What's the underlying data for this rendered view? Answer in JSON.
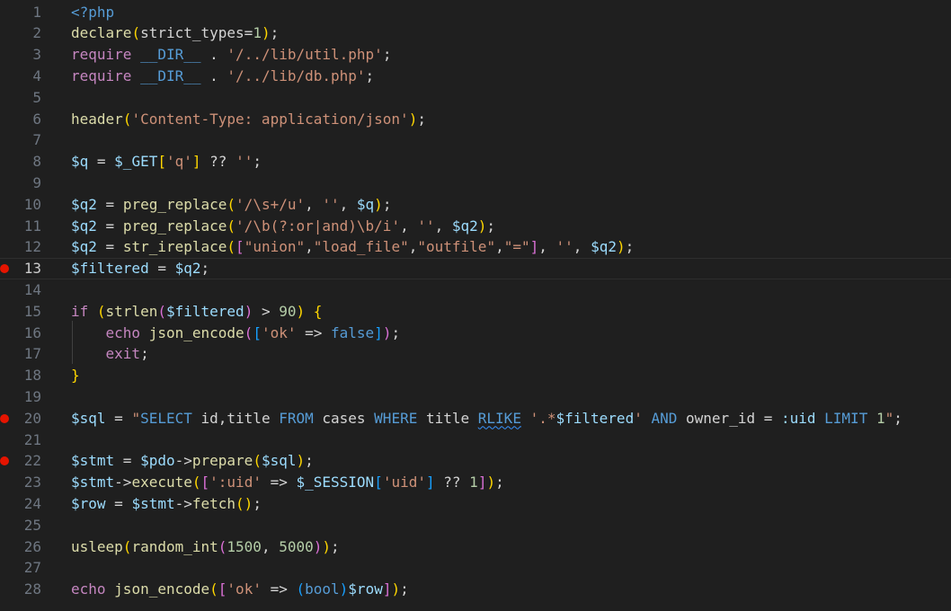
{
  "editor": {
    "lines": [
      {
        "n": "1",
        "tokens": [
          [
            "tag",
            "<?php"
          ]
        ]
      },
      {
        "n": "2",
        "tokens": [
          [
            "fn",
            "declare"
          ],
          [
            "b1",
            "("
          ],
          [
            "plain",
            "strict_types"
          ],
          [
            "op",
            "="
          ],
          [
            "num",
            "1"
          ],
          [
            "b1",
            ")"
          ],
          [
            "plain",
            ";"
          ]
        ]
      },
      {
        "n": "3",
        "tokens": [
          [
            "kw",
            "require"
          ],
          [
            "plain",
            " "
          ],
          [
            "tag",
            "__DIR__"
          ],
          [
            "plain",
            " . "
          ],
          [
            "str",
            "'/../lib/util.php'"
          ],
          [
            "plain",
            ";"
          ]
        ]
      },
      {
        "n": "4",
        "tokens": [
          [
            "kw",
            "require"
          ],
          [
            "plain",
            " "
          ],
          [
            "tag",
            "__DIR__"
          ],
          [
            "plain",
            " . "
          ],
          [
            "str",
            "'/../lib/db.php'"
          ],
          [
            "plain",
            ";"
          ]
        ]
      },
      {
        "n": "5",
        "tokens": []
      },
      {
        "n": "6",
        "tokens": [
          [
            "fn",
            "header"
          ],
          [
            "b1",
            "("
          ],
          [
            "str",
            "'Content-Type: application/json'"
          ],
          [
            "b1",
            ")"
          ],
          [
            "plain",
            ";"
          ]
        ]
      },
      {
        "n": "7",
        "tokens": []
      },
      {
        "n": "8",
        "tokens": [
          [
            "var",
            "$q"
          ],
          [
            "plain",
            " = "
          ],
          [
            "var",
            "$_GET"
          ],
          [
            "b1",
            "["
          ],
          [
            "str",
            "'q'"
          ],
          [
            "b1",
            "]"
          ],
          [
            "plain",
            " ?? "
          ],
          [
            "str",
            "''"
          ],
          [
            "plain",
            ";"
          ]
        ]
      },
      {
        "n": "9",
        "tokens": []
      },
      {
        "n": "10",
        "tokens": [
          [
            "var",
            "$q2"
          ],
          [
            "plain",
            " = "
          ],
          [
            "fn",
            "preg_replace"
          ],
          [
            "b1",
            "("
          ],
          [
            "str",
            "'/\\s+/u'"
          ],
          [
            "plain",
            ", "
          ],
          [
            "str",
            "''"
          ],
          [
            "plain",
            ", "
          ],
          [
            "var",
            "$q"
          ],
          [
            "b1",
            ")"
          ],
          [
            "plain",
            ";"
          ]
        ]
      },
      {
        "n": "11",
        "tokens": [
          [
            "var",
            "$q2"
          ],
          [
            "plain",
            " = "
          ],
          [
            "fn",
            "preg_replace"
          ],
          [
            "b1",
            "("
          ],
          [
            "str",
            "'/\\b(?:or|and)\\b/i'"
          ],
          [
            "plain",
            ", "
          ],
          [
            "str",
            "''"
          ],
          [
            "plain",
            ", "
          ],
          [
            "var",
            "$q2"
          ],
          [
            "b1",
            ")"
          ],
          [
            "plain",
            ";"
          ]
        ]
      },
      {
        "n": "12",
        "tokens": [
          [
            "var",
            "$q2"
          ],
          [
            "plain",
            " = "
          ],
          [
            "fn",
            "str_ireplace"
          ],
          [
            "b1",
            "("
          ],
          [
            "b2",
            "["
          ],
          [
            "str",
            "\"union\""
          ],
          [
            "plain",
            ","
          ],
          [
            "str",
            "\"load_file\""
          ],
          [
            "plain",
            ","
          ],
          [
            "str",
            "\"outfile\""
          ],
          [
            "plain",
            ","
          ],
          [
            "str",
            "\"=\""
          ],
          [
            "b2",
            "]"
          ],
          [
            "plain",
            ", "
          ],
          [
            "str",
            "''"
          ],
          [
            "plain",
            ", "
          ],
          [
            "var",
            "$q2"
          ],
          [
            "b1",
            ")"
          ],
          [
            "plain",
            ";"
          ]
        ]
      },
      {
        "n": "13",
        "tokens": [
          [
            "var",
            "$filtered"
          ],
          [
            "plain",
            " = "
          ],
          [
            "var",
            "$q2"
          ],
          [
            "plain",
            ";"
          ]
        ],
        "current": true,
        "bp": true
      },
      {
        "n": "14",
        "tokens": []
      },
      {
        "n": "15",
        "tokens": [
          [
            "kw",
            "if"
          ],
          [
            "plain",
            " "
          ],
          [
            "b1",
            "("
          ],
          [
            "fn",
            "strlen"
          ],
          [
            "b2",
            "("
          ],
          [
            "var",
            "$filtered"
          ],
          [
            "b2",
            ")"
          ],
          [
            "plain",
            " > "
          ],
          [
            "num",
            "90"
          ],
          [
            "b1",
            ")"
          ],
          [
            "plain",
            " "
          ],
          [
            "b1",
            "{"
          ]
        ]
      },
      {
        "n": "16",
        "tokens": [
          [
            "plain",
            "    "
          ],
          [
            "kw",
            "echo"
          ],
          [
            "plain",
            " "
          ],
          [
            "fn",
            "json_encode"
          ],
          [
            "b2",
            "("
          ],
          [
            "b3",
            "["
          ],
          [
            "str",
            "'ok'"
          ],
          [
            "plain",
            " => "
          ],
          [
            "tag",
            "false"
          ],
          [
            "b3",
            "]"
          ],
          [
            "b2",
            ")"
          ],
          [
            "plain",
            ";"
          ]
        ]
      },
      {
        "n": "17",
        "tokens": [
          [
            "plain",
            "    "
          ],
          [
            "kw",
            "exit"
          ],
          [
            "plain",
            ";"
          ]
        ]
      },
      {
        "n": "18",
        "tokens": [
          [
            "b1",
            "}"
          ]
        ]
      },
      {
        "n": "19",
        "tokens": []
      },
      {
        "n": "20",
        "tokens": [
          [
            "var",
            "$sql"
          ],
          [
            "plain",
            " = "
          ],
          [
            "str",
            "\""
          ],
          [
            "sqlk",
            "SELECT"
          ],
          [
            "sqlt",
            " id,title "
          ],
          [
            "sqlk",
            "FROM"
          ],
          [
            "sqlt",
            " cases "
          ],
          [
            "sqlk",
            "WHERE"
          ],
          [
            "sqlt",
            " title "
          ],
          [
            "sqlk squig",
            "RLIKE"
          ],
          [
            "sqlt",
            " "
          ],
          [
            "str",
            "'.*"
          ],
          [
            "var",
            "$filtered"
          ],
          [
            "str",
            "'"
          ],
          [
            "sqlt",
            " "
          ],
          [
            "sqlk",
            "AND"
          ],
          [
            "sqlt",
            " owner_id = "
          ],
          [
            "var",
            ":uid"
          ],
          [
            "sqlt",
            " "
          ],
          [
            "sqlk",
            "LIMIT"
          ],
          [
            "sqlt",
            " "
          ],
          [
            "num",
            "1"
          ],
          [
            "str",
            "\""
          ],
          [
            "plain",
            ";"
          ]
        ],
        "bp": true
      },
      {
        "n": "21",
        "tokens": []
      },
      {
        "n": "22",
        "tokens": [
          [
            "var",
            "$stmt"
          ],
          [
            "plain",
            " = "
          ],
          [
            "var",
            "$pdo"
          ],
          [
            "plain",
            "->"
          ],
          [
            "fn",
            "prepare"
          ],
          [
            "b1",
            "("
          ],
          [
            "var",
            "$sql"
          ],
          [
            "b1",
            ")"
          ],
          [
            "plain",
            ";"
          ]
        ],
        "bp": true
      },
      {
        "n": "23",
        "tokens": [
          [
            "var",
            "$stmt"
          ],
          [
            "plain",
            "->"
          ],
          [
            "fn",
            "execute"
          ],
          [
            "b1",
            "("
          ],
          [
            "b2",
            "["
          ],
          [
            "str",
            "':uid'"
          ],
          [
            "plain",
            " => "
          ],
          [
            "var",
            "$_SESSION"
          ],
          [
            "b3",
            "["
          ],
          [
            "str",
            "'uid'"
          ],
          [
            "b3",
            "]"
          ],
          [
            "plain",
            " ?? "
          ],
          [
            "num",
            "1"
          ],
          [
            "b2",
            "]"
          ],
          [
            "b1",
            ")"
          ],
          [
            "plain",
            ";"
          ]
        ]
      },
      {
        "n": "24",
        "tokens": [
          [
            "var",
            "$row"
          ],
          [
            "plain",
            " = "
          ],
          [
            "var",
            "$stmt"
          ],
          [
            "plain",
            "->"
          ],
          [
            "fn",
            "fetch"
          ],
          [
            "b1",
            "()"
          ],
          [
            "plain",
            ";"
          ]
        ]
      },
      {
        "n": "25",
        "tokens": []
      },
      {
        "n": "26",
        "tokens": [
          [
            "fn",
            "usleep"
          ],
          [
            "b1",
            "("
          ],
          [
            "fn",
            "random_int"
          ],
          [
            "b2",
            "("
          ],
          [
            "num",
            "1500"
          ],
          [
            "plain",
            ", "
          ],
          [
            "num",
            "5000"
          ],
          [
            "b2",
            ")"
          ],
          [
            "b1",
            ")"
          ],
          [
            "plain",
            ";"
          ]
        ]
      },
      {
        "n": "27",
        "tokens": []
      },
      {
        "n": "28",
        "tokens": [
          [
            "kw",
            "echo"
          ],
          [
            "plain",
            " "
          ],
          [
            "fn",
            "json_encode"
          ],
          [
            "b1",
            "("
          ],
          [
            "b2",
            "["
          ],
          [
            "str",
            "'ok'"
          ],
          [
            "plain",
            " => "
          ],
          [
            "b3",
            "("
          ],
          [
            "tag",
            "bool"
          ],
          [
            "b3",
            ")"
          ],
          [
            "var",
            "$row"
          ],
          [
            "b2",
            "]"
          ],
          [
            "b1",
            ")"
          ],
          [
            "plain",
            ";"
          ]
        ]
      }
    ]
  }
}
